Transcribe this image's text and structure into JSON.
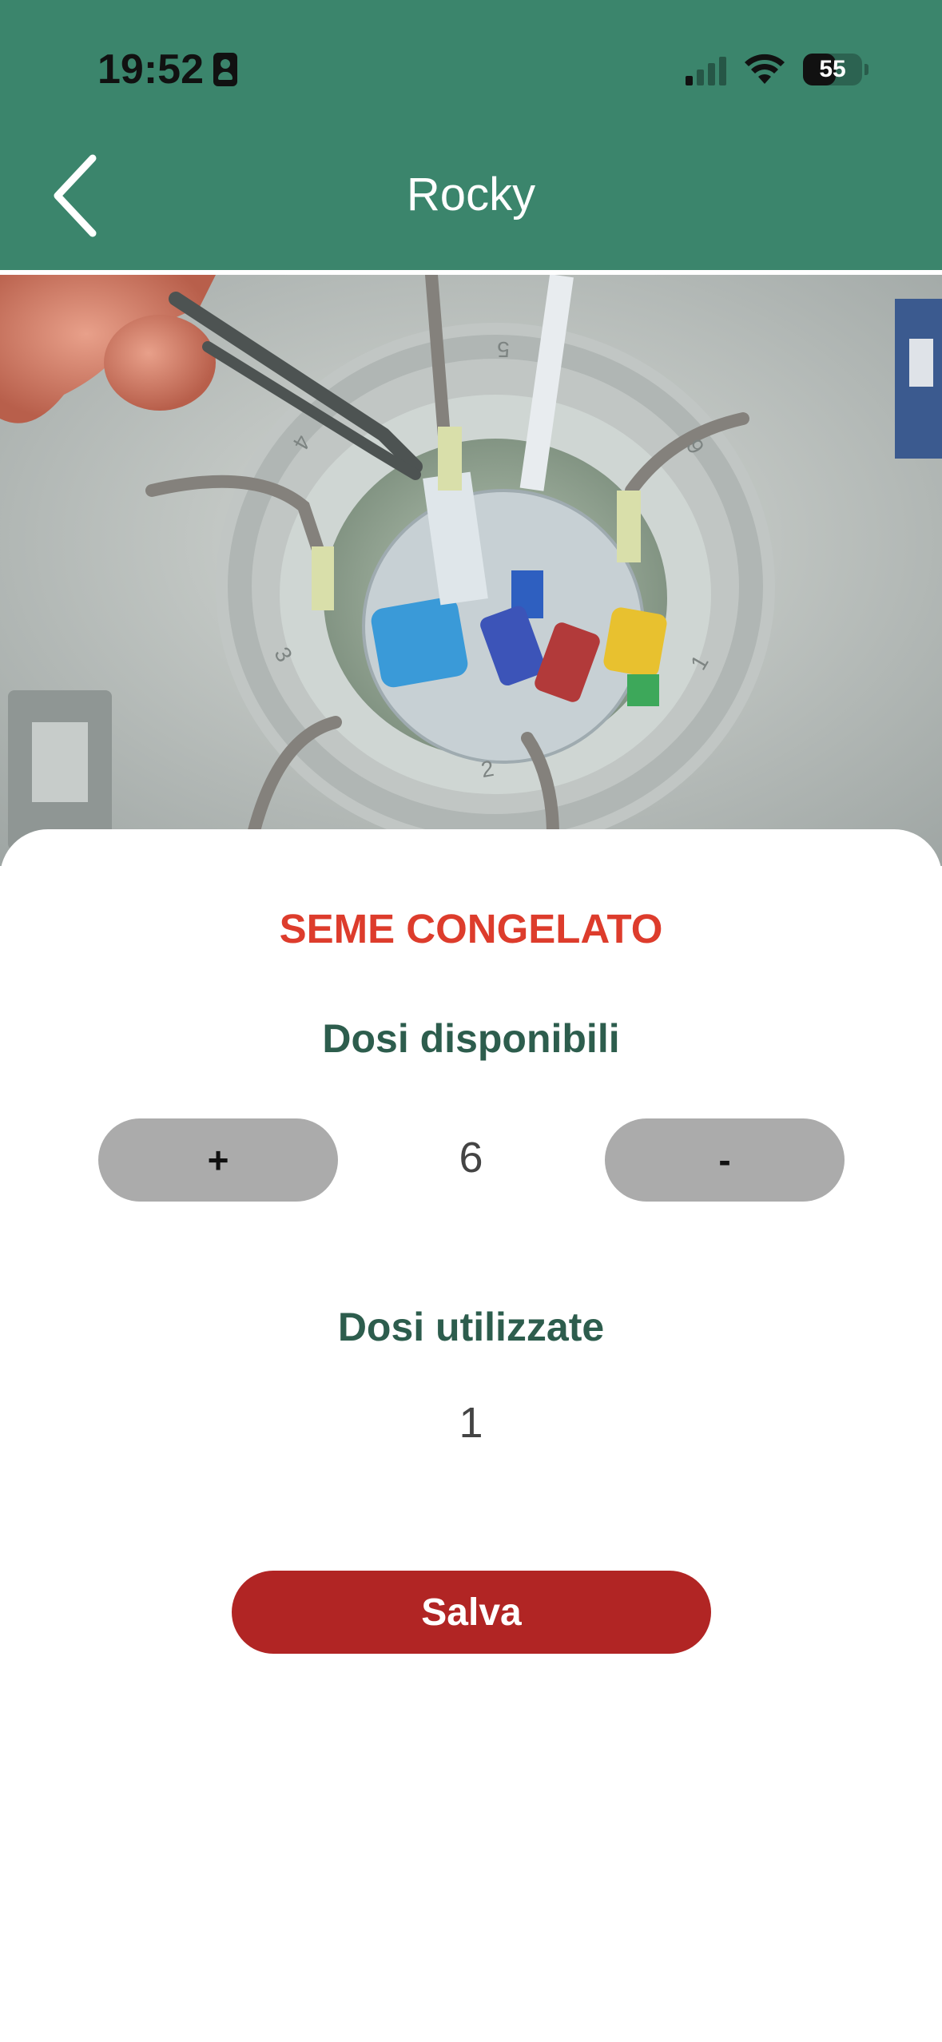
{
  "status_bar": {
    "time": "19:52",
    "battery": "55",
    "battery_level": 0.55
  },
  "header": {
    "title": "Rocky"
  },
  "photo": {
    "ring_numbers": [
      "5",
      "6",
      "4",
      "3",
      "2",
      "1"
    ]
  },
  "card": {
    "section_title": "SEME CONGELATO",
    "available": {
      "label": "Dosi disponibili",
      "value": "6",
      "plus_label": "+",
      "minus_label": "-"
    },
    "used": {
      "label": "Dosi utilizzate",
      "value": "1"
    },
    "save_label": "Salva"
  },
  "colors": {
    "header": "#3b856c",
    "accent_red": "#dd3c2c",
    "save_button": "#b12524",
    "label_green": "#2d5d4d",
    "stepper": "#ababab"
  }
}
